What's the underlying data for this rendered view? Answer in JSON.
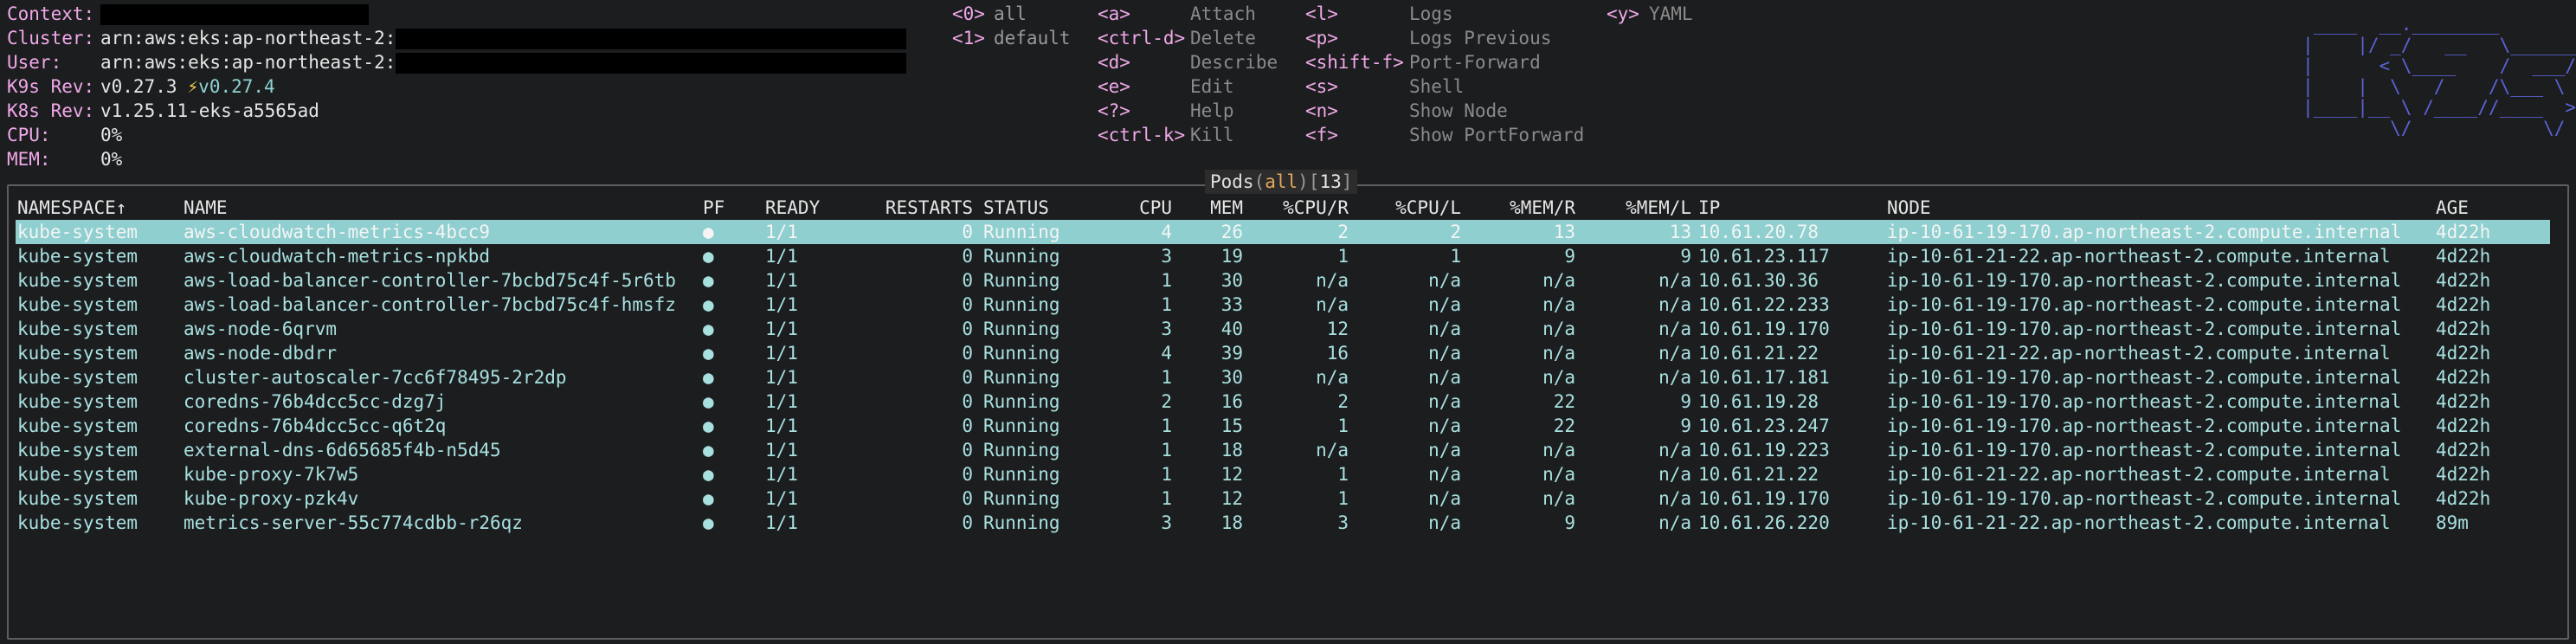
{
  "info": [
    {
      "key": "Context:",
      "value": "",
      "redacted": true,
      "redact_width": 310
    },
    {
      "key": "Cluster:",
      "value": "arn:aws:eks:ap-northeast-2:",
      "redacted": true,
      "redact_width": 590
    },
    {
      "key": "User:",
      "value": "arn:aws:eks:ap-northeast-2:",
      "redacted": true,
      "redact_width": 590
    },
    {
      "key": "K9s Rev:",
      "value": "v0.27.3",
      "bolt": "⚡",
      "alt": "v0.27.4"
    },
    {
      "key": "K8s Rev:",
      "value": "v1.25.11-eks-a5565ad"
    },
    {
      "key": "CPU:",
      "value": "0%"
    },
    {
      "key": "MEM:",
      "value": "0%"
    }
  ],
  "namespaces": [
    {
      "key": "<0>",
      "label": "all"
    },
    {
      "key": "<1>",
      "label": "default"
    }
  ],
  "hotkeys_col1": [
    {
      "key": "<a>",
      "label": "Attach"
    },
    {
      "key": "<ctrl-d>",
      "label": "Delete"
    },
    {
      "key": "<d>",
      "label": "Describe"
    },
    {
      "key": "<e>",
      "label": "Edit"
    },
    {
      "key": "<?>",
      "label": "Help"
    },
    {
      "key": "<ctrl-k>",
      "label": "Kill"
    }
  ],
  "hotkeys_col2": [
    {
      "key": "<l>",
      "label": "Logs"
    },
    {
      "key": "<p>",
      "label": "Logs Previous"
    },
    {
      "key": "<shift-f>",
      "label": "Port-Forward"
    },
    {
      "key": "<s>",
      "label": "Shell"
    },
    {
      "key": "<n>",
      "label": "Show Node"
    },
    {
      "key": "<f>",
      "label": "Show PortForward"
    }
  ],
  "hotkeys_col3": [
    {
      "key": "<y>",
      "label": "YAML"
    }
  ],
  "logo": [
    " ____  __.________        ",
    "|    |/ _/   __   \\______ ",
    "|      < \\____    /  ___/ ",
    "|    |  \\   /    /\\___ \\  ",
    "|____|__ \\ /____//____  > ",
    "        \\/            \\/  "
  ],
  "table_title": {
    "resource": "Pods",
    "open": "(",
    "filter": "all",
    "close": ")",
    "lbracket": "[",
    "count": "13",
    "rbracket": "]"
  },
  "columns": [
    "NAMESPACE↑",
    "NAME",
    "PF",
    "READY",
    "RESTARTS",
    "STATUS",
    "CPU",
    "MEM",
    "%CPU/R",
    "%CPU/L",
    "%MEM/R",
    "%MEM/L",
    "IP",
    "NODE",
    "AGE"
  ],
  "rows": [
    {
      "namespace": "kube-system",
      "name": "aws-cloudwatch-metrics-4bcc9",
      "pf": "●",
      "ready": "1/1",
      "restarts": "0",
      "status": "Running",
      "cpu": "4",
      "mem": "26",
      "cpu_r": "2",
      "cpu_l": "2",
      "mem_r": "13",
      "mem_l": "13",
      "ip": "10.61.20.78",
      "node": "ip-10-61-19-170.ap-northeast-2.compute.internal",
      "age": "4d22h",
      "selected": true
    },
    {
      "namespace": "kube-system",
      "name": "aws-cloudwatch-metrics-npkbd",
      "pf": "●",
      "ready": "1/1",
      "restarts": "0",
      "status": "Running",
      "cpu": "3",
      "mem": "19",
      "cpu_r": "1",
      "cpu_l": "1",
      "mem_r": "9",
      "mem_l": "9",
      "ip": "10.61.23.117",
      "node": "ip-10-61-21-22.ap-northeast-2.compute.internal",
      "age": "4d22h"
    },
    {
      "namespace": "kube-system",
      "name": "aws-load-balancer-controller-7bcbd75c4f-5r6tb",
      "pf": "●",
      "ready": "1/1",
      "restarts": "0",
      "status": "Running",
      "cpu": "1",
      "mem": "30",
      "cpu_r": "n/a",
      "cpu_l": "n/a",
      "mem_r": "n/a",
      "mem_l": "n/a",
      "ip": "10.61.30.36",
      "node": "ip-10-61-19-170.ap-northeast-2.compute.internal",
      "age": "4d22h"
    },
    {
      "namespace": "kube-system",
      "name": "aws-load-balancer-controller-7bcbd75c4f-hmsfz",
      "pf": "●",
      "ready": "1/1",
      "restarts": "0",
      "status": "Running",
      "cpu": "1",
      "mem": "33",
      "cpu_r": "n/a",
      "cpu_l": "n/a",
      "mem_r": "n/a",
      "mem_l": "n/a",
      "ip": "10.61.22.233",
      "node": "ip-10-61-19-170.ap-northeast-2.compute.internal",
      "age": "4d22h"
    },
    {
      "namespace": "kube-system",
      "name": "aws-node-6qrvm",
      "pf": "●",
      "ready": "1/1",
      "restarts": "0",
      "status": "Running",
      "cpu": "3",
      "mem": "40",
      "cpu_r": "12",
      "cpu_l": "n/a",
      "mem_r": "n/a",
      "mem_l": "n/a",
      "ip": "10.61.19.170",
      "node": "ip-10-61-19-170.ap-northeast-2.compute.internal",
      "age": "4d22h"
    },
    {
      "namespace": "kube-system",
      "name": "aws-node-dbdrr",
      "pf": "●",
      "ready": "1/1",
      "restarts": "0",
      "status": "Running",
      "cpu": "4",
      "mem": "39",
      "cpu_r": "16",
      "cpu_l": "n/a",
      "mem_r": "n/a",
      "mem_l": "n/a",
      "ip": "10.61.21.22",
      "node": "ip-10-61-21-22.ap-northeast-2.compute.internal",
      "age": "4d22h"
    },
    {
      "namespace": "kube-system",
      "name": "cluster-autoscaler-7cc6f78495-2r2dp",
      "pf": "●",
      "ready": "1/1",
      "restarts": "0",
      "status": "Running",
      "cpu": "1",
      "mem": "30",
      "cpu_r": "n/a",
      "cpu_l": "n/a",
      "mem_r": "n/a",
      "mem_l": "n/a",
      "ip": "10.61.17.181",
      "node": "ip-10-61-19-170.ap-northeast-2.compute.internal",
      "age": "4d22h"
    },
    {
      "namespace": "kube-system",
      "name": "coredns-76b4dcc5cc-dzg7j",
      "pf": "●",
      "ready": "1/1",
      "restarts": "0",
      "status": "Running",
      "cpu": "2",
      "mem": "16",
      "cpu_r": "2",
      "cpu_l": "n/a",
      "mem_r": "22",
      "mem_l": "9",
      "ip": "10.61.19.28",
      "node": "ip-10-61-19-170.ap-northeast-2.compute.internal",
      "age": "4d22h"
    },
    {
      "namespace": "kube-system",
      "name": "coredns-76b4dcc5cc-q6t2q",
      "pf": "●",
      "ready": "1/1",
      "restarts": "0",
      "status": "Running",
      "cpu": "1",
      "mem": "15",
      "cpu_r": "1",
      "cpu_l": "n/a",
      "mem_r": "22",
      "mem_l": "9",
      "ip": "10.61.23.247",
      "node": "ip-10-61-19-170.ap-northeast-2.compute.internal",
      "age": "4d22h"
    },
    {
      "namespace": "kube-system",
      "name": "external-dns-6d65685f4b-n5d45",
      "pf": "●",
      "ready": "1/1",
      "restarts": "0",
      "status": "Running",
      "cpu": "1",
      "mem": "18",
      "cpu_r": "n/a",
      "cpu_l": "n/a",
      "mem_r": "n/a",
      "mem_l": "n/a",
      "ip": "10.61.19.223",
      "node": "ip-10-61-19-170.ap-northeast-2.compute.internal",
      "age": "4d22h"
    },
    {
      "namespace": "kube-system",
      "name": "kube-proxy-7k7w5",
      "pf": "●",
      "ready": "1/1",
      "restarts": "0",
      "status": "Running",
      "cpu": "1",
      "mem": "12",
      "cpu_r": "1",
      "cpu_l": "n/a",
      "mem_r": "n/a",
      "mem_l": "n/a",
      "ip": "10.61.21.22",
      "node": "ip-10-61-21-22.ap-northeast-2.compute.internal",
      "age": "4d22h"
    },
    {
      "namespace": "kube-system",
      "name": "kube-proxy-pzk4v",
      "pf": "●",
      "ready": "1/1",
      "restarts": "0",
      "status": "Running",
      "cpu": "1",
      "mem": "12",
      "cpu_r": "1",
      "cpu_l": "n/a",
      "mem_r": "n/a",
      "mem_l": "n/a",
      "ip": "10.61.19.170",
      "node": "ip-10-61-19-170.ap-northeast-2.compute.internal",
      "age": "4d22h"
    },
    {
      "namespace": "kube-system",
      "name": "metrics-server-55c774cdbb-r26qz",
      "pf": "●",
      "ready": "1/1",
      "restarts": "0",
      "status": "Running",
      "cpu": "3",
      "mem": "18",
      "cpu_r": "3",
      "cpu_l": "n/a",
      "mem_r": "9",
      "mem_l": "n/a",
      "ip": "10.61.26.220",
      "node": "ip-10-61-21-22.ap-northeast-2.compute.internal",
      "age": "89m"
    }
  ]
}
